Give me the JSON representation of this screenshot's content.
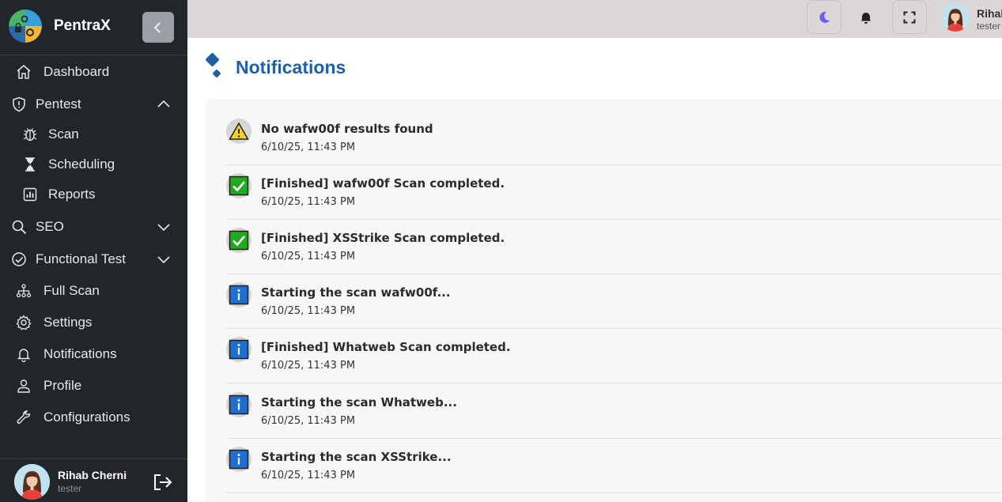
{
  "brand": {
    "name": "PentraX",
    "logo_icon": "pentrax-logo-icon"
  },
  "sidebar": {
    "items": [
      {
        "label": "Dashboard",
        "icon": "home-icon"
      },
      {
        "label": "Pentest",
        "icon": "shield-icon",
        "expanded": true
      },
      {
        "label": "Scan",
        "icon": "bug-icon"
      },
      {
        "label": "Scheduling",
        "icon": "hourglass-icon"
      },
      {
        "label": "Reports",
        "icon": "report-chart-icon"
      },
      {
        "label": "SEO",
        "icon": "search-icon",
        "expanded": false
      },
      {
        "label": "Functional Test",
        "icon": "check-circle-icon",
        "expanded": false
      },
      {
        "label": "Full Scan",
        "icon": "sitemap-icon"
      },
      {
        "label": "Settings",
        "icon": "gear-icon"
      },
      {
        "label": "Notifications",
        "icon": "bell-icon"
      },
      {
        "label": "Profile",
        "icon": "user-icon"
      },
      {
        "label": "Configurations",
        "icon": "wrench-icon"
      }
    ]
  },
  "user": {
    "name": "Rihab Cherni",
    "role": "tester",
    "top_name": "Rihab",
    "top_role": "tester"
  },
  "topbar": {
    "icons": [
      "moon-icon",
      "bell-icon",
      "fullscreen-icon"
    ]
  },
  "page": {
    "title": "Notifications"
  },
  "notifications": [
    {
      "type": "warning",
      "text": "No wafw00f results found",
      "time": "6/10/25, 11:43 PM"
    },
    {
      "type": "success",
      "text": "[Finished] wafw00f Scan completed.",
      "time": "6/10/25, 11:43 PM"
    },
    {
      "type": "success",
      "text": "[Finished] XSStrike Scan completed.",
      "time": "6/10/25, 11:43 PM"
    },
    {
      "type": "info",
      "text": "Starting the scan wafw00f...",
      "time": "6/10/25, 11:43 PM"
    },
    {
      "type": "info",
      "text": "[Finished] Whatweb Scan completed.",
      "time": "6/10/25, 11:43 PM"
    },
    {
      "type": "info",
      "text": "Starting the scan Whatweb...",
      "time": "6/10/25, 11:43 PM"
    },
    {
      "type": "info",
      "text": "Starting the scan XSStrike...",
      "time": "6/10/25, 11:43 PM"
    }
  ],
  "colors": {
    "sidebar_bg": "#22262b",
    "topbar_bg": "#ddd6d6",
    "title": "#1f5fa6",
    "moon": "#6a5cff",
    "success": "#1faa1f",
    "warning": "#f4d21f",
    "info": "#1f6fd1"
  }
}
